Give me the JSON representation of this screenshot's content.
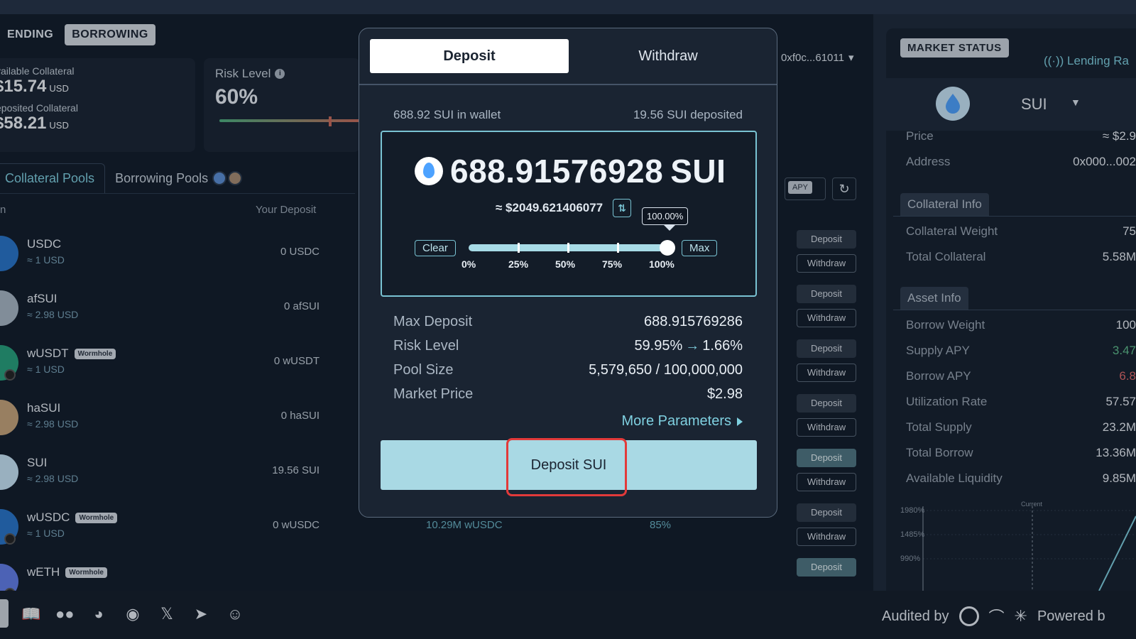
{
  "mode_tabs": [
    {
      "label": "ENDING",
      "active": false
    },
    {
      "label": "BORROWING",
      "active": true
    }
  ],
  "summary": {
    "available_label": "vailable Collateral",
    "available_value": "$15.74",
    "available_unit": "USD",
    "deposited_label": "eposited Collateral",
    "deposited_value": "$58.21",
    "deposited_unit": "USD"
  },
  "risk": {
    "label": "Risk Level",
    "value": "60%"
  },
  "pool_tabs": [
    {
      "label": "Collateral Pools",
      "active": true
    },
    {
      "label": "Borrowing Pools",
      "active": false
    }
  ],
  "table": {
    "col_name": "n",
    "col_deposit": "Your Deposit"
  },
  "pools": [
    {
      "name": "USDC",
      "price": "≈ 1 USD",
      "deposit": "0 USDC",
      "tag": "",
      "coin_color": "#2775ca",
      "pool": "",
      "pct": "",
      "dep_label": "Deposit",
      "wd_label": "Withdraw",
      "highlight": false
    },
    {
      "name": "afSUI",
      "price": "≈ 2.98 USD",
      "deposit": "0 afSUI",
      "tag": "",
      "coin_color": "#a9b7c4",
      "pool": "",
      "pct": "",
      "dep_label": "Deposit",
      "wd_label": "Withdraw",
      "highlight": false
    },
    {
      "name": "wUSDT",
      "price": "≈ 1 USD",
      "deposit": "0 wUSDT",
      "tag": "Wormhole",
      "coin_color": "#26a17b",
      "pool": "",
      "pct": "",
      "dep_label": "Deposit",
      "wd_label": "Withdraw",
      "highlight": false
    },
    {
      "name": "haSUI",
      "price": "≈ 2.98 USD",
      "deposit": "0 haSUI",
      "tag": "",
      "coin_color": "#c7a57a",
      "pool": "",
      "pct": "",
      "dep_label": "Deposit",
      "wd_label": "Withdraw",
      "highlight": false
    },
    {
      "name": "SUI",
      "price": "≈ 2.98 USD",
      "deposit": "19.56 SUI",
      "tag": "",
      "coin_color": "#c8e6f7",
      "pool": "",
      "pct": "",
      "dep_label": "Deposit",
      "wd_label": "Withdraw",
      "highlight": true
    },
    {
      "name": "wUSDC",
      "price": "≈ 1 USD",
      "deposit": "0 wUSDC",
      "tag": "Wormhole",
      "coin_color": "#2775ca",
      "pool": "10.29M wUSDC",
      "pct": "85%",
      "dep_label": "Deposit",
      "wd_label": "Withdraw",
      "highlight": false
    },
    {
      "name": "wETH",
      "price": "",
      "deposit": "",
      "tag": "Wormhole",
      "coin_color": "#627eea",
      "pool": "",
      "pct": "",
      "dep_label": "Deposit",
      "wd_label": "",
      "highlight": true
    }
  ],
  "wallet": {
    "address": "0xf0c...61011"
  },
  "apy_toggle": "APY",
  "market": {
    "title": "MARKET STATUS",
    "lending_rate": "Lending Ra",
    "asset": "SUI",
    "price_label": "Price",
    "price_value": "≈ $2.9",
    "address_label": "Address",
    "address_value": "0x000...002",
    "collateral_section": "Collateral Info",
    "collateral_weight_label": "Collateral Weight",
    "collateral_weight_value": "75",
    "total_collateral_label": "Total Collateral",
    "total_collateral_value": "5.58M",
    "asset_section": "Asset Info",
    "borrow_weight_label": "Borrow Weight",
    "borrow_weight_value": "100",
    "supply_apy_label": "Supply APY",
    "supply_apy_value": "3.47",
    "borrow_apy_label": "Borrow APY",
    "borrow_apy_value": "6.8",
    "utilization_label": "Utilization Rate",
    "utilization_value": "57.57",
    "total_supply_label": "Total Supply",
    "total_supply_value": "23.2M",
    "total_borrow_label": "Total Borrow",
    "total_borrow_value": "13.36M",
    "liquidity_label": "Available Liquidity",
    "liquidity_value": "9.85M",
    "chart_ticks": [
      "1980%",
      "1485%",
      "990%"
    ],
    "chart_current": "Current"
  },
  "modal": {
    "tab_deposit": "Deposit",
    "tab_withdraw": "Withdraw",
    "wallet_balance": "688.92 SUI in wallet",
    "deposited": "19.56 SUI deposited",
    "amount": "688.91576928",
    "amount_unit": "SUI",
    "usd_value": "≈ $2049.621406077",
    "clear_label": "Clear",
    "max_label": "Max",
    "slider_percent": 100,
    "slider_tooltip": "100.00%",
    "slider_labels": [
      "0%",
      "25%",
      "50%",
      "75%",
      "100%"
    ],
    "max_deposit_label": "Max Deposit",
    "max_deposit_value": "688.915769286",
    "risk_label": "Risk Level",
    "risk_from": "59.95%",
    "risk_to": "1.66%",
    "pool_size_label": "Pool Size",
    "pool_size_value": "5,579,650 / 100,000,000",
    "market_price_label": "Market Price",
    "market_price_value": "$2.98",
    "more_params": "More Parameters",
    "deposit_button": "Deposit SUI"
  },
  "footer": {
    "audited_by": "Audited by",
    "powered_by": "Powered b"
  }
}
